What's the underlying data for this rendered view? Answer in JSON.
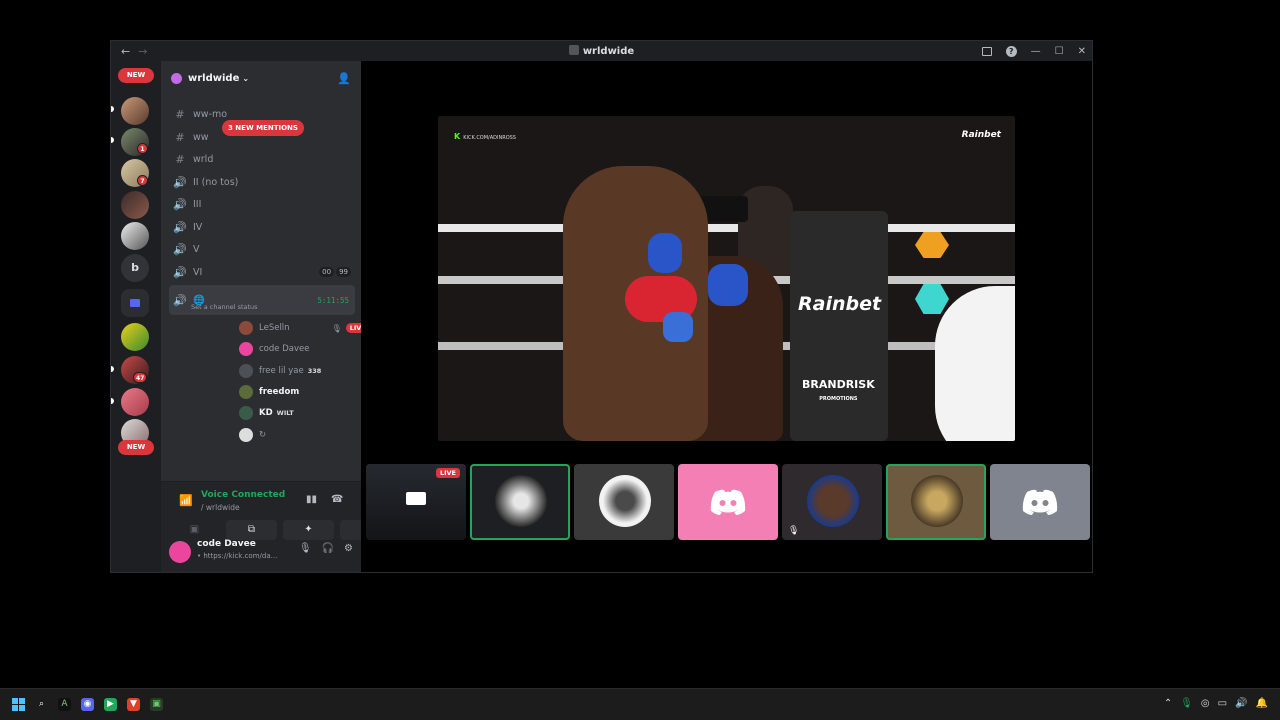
{
  "window": {
    "title": "wrldwide",
    "nav_back": "←",
    "nav_forward": "→",
    "controls": {
      "inbox": "inbox-icon",
      "help": "?",
      "minimize": "—",
      "maximize": "☐",
      "close": "✕"
    }
  },
  "rail": {
    "new_top": "NEW",
    "new_bottom": "NEW",
    "badges": [
      "1",
      "7",
      "47"
    ],
    "letter_server": "b"
  },
  "server": {
    "name": "wrldwide",
    "dropdown": "⌄",
    "mentions_pill": "3 NEW MENTIONS",
    "channels": [
      {
        "type": "text",
        "name": "ww-mo"
      },
      {
        "type": "text",
        "name": "ww"
      },
      {
        "type": "text",
        "name": "wrld"
      },
      {
        "type": "voice",
        "name": "II (no tos)"
      },
      {
        "type": "voice",
        "name": "III"
      },
      {
        "type": "voice",
        "name": "IV"
      },
      {
        "type": "voice",
        "name": "V"
      },
      {
        "type": "voice",
        "name": "VI",
        "counts": [
          "00",
          "99"
        ]
      }
    ],
    "active_voice": {
      "icon": "🌐",
      "timer": "5:11:55",
      "status": "Set a channel status"
    },
    "members": [
      {
        "name": "LeSelln",
        "live": "LIVE",
        "color": "#8b4a3a"
      },
      {
        "name": "code Davee",
        "color": "#eb459e"
      },
      {
        "name": "free lil yae",
        "tag": "338",
        "color": "#4e5058"
      },
      {
        "name": "freedom",
        "color": "#5b6b3a",
        "bright": true
      },
      {
        "name": "KD",
        "tag": "WILT",
        "color": "#3a5b4a",
        "bright": true
      },
      {
        "name": "↻",
        "color": "#dddddd"
      }
    ]
  },
  "voice": {
    "connected": "Voice Connected",
    "channel": "/ wrldwide"
  },
  "user": {
    "name": "code Davee",
    "status": "• https://kick.com/da..."
  },
  "stream": {
    "kick_tag": "KICK.COM/ADINROSS",
    "watermark": "Rainbet",
    "pad_brand": "Rainbet",
    "pad_brand2": "BRANDRISK",
    "pad_brand2_sub": "PROMOTIONS"
  },
  "tiles": {
    "live_label": "LIVE"
  },
  "colors": {
    "accent": "#5865f2",
    "green": "#23a55a",
    "red": "#da373c",
    "pink": "#eb459e",
    "grey": "#80848e"
  }
}
